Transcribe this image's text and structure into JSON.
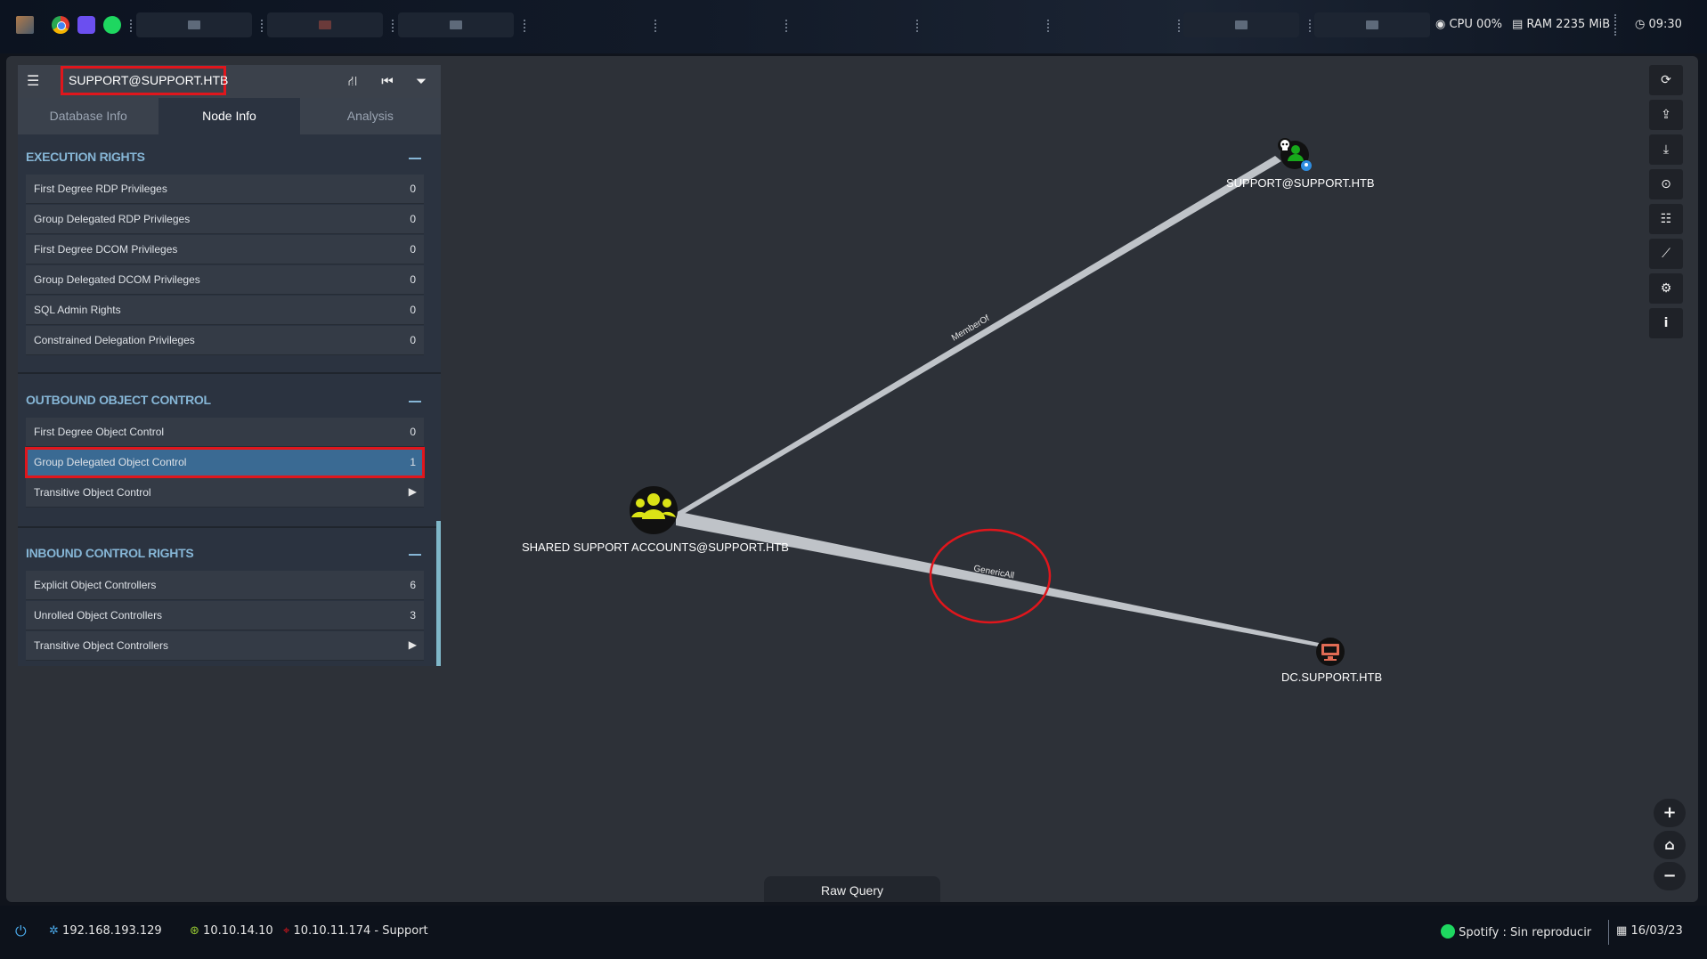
{
  "topbar": {
    "cpu_label": "CPU 00%",
    "ram_label": "RAM 2235 MiB",
    "clock": "09:30"
  },
  "panel": {
    "search_value": "SUPPORT@SUPPORT.HTB",
    "tabs": [
      "Database Info",
      "Node Info",
      "Analysis"
    ],
    "active_tab": "Node Info",
    "sections": {
      "execution_rights": {
        "title": "EXECUTION RIGHTS",
        "rows": [
          {
            "label": "First Degree RDP Privileges",
            "value": "0"
          },
          {
            "label": "Group Delegated RDP Privileges",
            "value": "0"
          },
          {
            "label": "First Degree DCOM Privileges",
            "value": "0"
          },
          {
            "label": "Group Delegated DCOM Privileges",
            "value": "0"
          },
          {
            "label": "SQL Admin Rights",
            "value": "0"
          },
          {
            "label": "Constrained Delegation Privileges",
            "value": "0"
          }
        ]
      },
      "outbound_object_control": {
        "title": "OUTBOUND OBJECT CONTROL",
        "rows": [
          {
            "label": "First Degree Object Control",
            "value": "0"
          },
          {
            "label": "Group Delegated Object Control",
            "value": "1"
          },
          {
            "label": "Transitive Object Control",
            "value": ""
          }
        ]
      },
      "inbound_control_rights": {
        "title": "INBOUND CONTROL RIGHTS",
        "rows": [
          {
            "label": "Explicit Object Controllers",
            "value": "6"
          },
          {
            "label": "Unrolled Object Controllers",
            "value": "3"
          },
          {
            "label": "Transitive Object Controllers",
            "value": ""
          }
        ]
      }
    }
  },
  "graph": {
    "nodes": {
      "user": {
        "label": "SUPPORT@SUPPORT.HTB",
        "icon": "user-icon",
        "color": "#17a81b"
      },
      "group": {
        "label": "SHARED SUPPORT ACCOUNTS@SUPPORT.HTB",
        "icon": "group-icon",
        "color": "#dbe316"
      },
      "computer": {
        "label": "DC.SUPPORT.HTB",
        "icon": "computer-icon",
        "color": "#e06b54"
      }
    },
    "edges": {
      "member_of": "MemberOf",
      "generic_all": "GenericAll"
    }
  },
  "raw_query_label": "Raw Query",
  "bottombar": {
    "local_ip": "192.168.193.129",
    "vpn_ip": "10.10.14.10",
    "target": "10.10.11.174 - Support",
    "spotify": "Spotify : Sin reproducir",
    "date": "16/03/23"
  },
  "colors": {
    "accent_red": "#e0161c",
    "section_title": "#86b6d6",
    "highlight_row": "#3a6a93"
  }
}
